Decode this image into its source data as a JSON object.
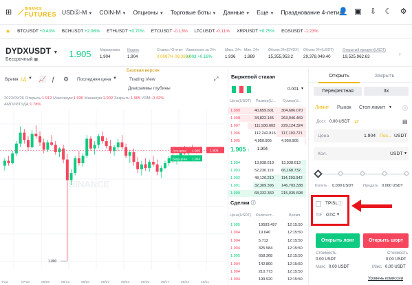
{
  "nav": {
    "brand_top": "BINANCE",
    "brand_bottom": "FUTURES",
    "items": [
      "USDⓈ-M",
      "COIN-M",
      "Опционы",
      "Торговые боты",
      "Данные",
      "Еще"
    ],
    "promo": "Празднование 4-летия Binan"
  },
  "ticker": [
    {
      "sym": "BTCUSDT",
      "chg": "+0.43%",
      "dir": "up"
    },
    {
      "sym": "BCHUSDT",
      "chg": "+2.98%",
      "dir": "up"
    },
    {
      "sym": "ETHUSDT",
      "chg": "+0.70%",
      "dir": "up"
    },
    {
      "sym": "ETCUSDT",
      "chg": "-0.13%",
      "dir": "dn"
    },
    {
      "sym": "LTCUSDT",
      "chg": "-0.11%",
      "dir": "dn"
    },
    {
      "sym": "XRPUSDT",
      "chg": "+0.75%",
      "dir": "up"
    },
    {
      "sym": "EOSUSDT",
      "chg": "-1.23%",
      "dir": "dn"
    }
  ],
  "header": {
    "symbol": "DYDXUSDT",
    "contract": "Бессрочный",
    "price": "1.905",
    "stats": [
      {
        "label": "Маркировка",
        "value": "1.904"
      },
      {
        "label": "Индекс",
        "value": "1.904"
      },
      {
        "label": "Ставка / Отсчет",
        "value": "0.0087% 06:38:40"
      },
      {
        "label": "Изменение за 24ч",
        "value": "0.003 +0.16%"
      },
      {
        "label": "Макс. 24ч",
        "value": "1.936"
      },
      {
        "label": "Мин. 24ч",
        "value": "1.889"
      },
      {
        "label": "Объем 24ч(DYDX)",
        "value": "15,355,953.2"
      },
      {
        "label": "Объем 24ч(USDT)",
        "value": "29,378,049.40"
      },
      {
        "label": "Открытый процент(USDT)",
        "value": "19,525,962.63"
      }
    ]
  },
  "chart_tools": {
    "time": "Время",
    "interval": "1Д",
    "price_type": "Последняя цена",
    "basic": "Базовая версия",
    "tv": "Trading View",
    "depth": "Диаграммы глубины"
  },
  "chart_info": {
    "line1_date": "2023/09/26",
    "open_l": "Открыть:",
    "open_v": "1.912",
    "high_l": "Максимум:",
    "high_v": "1.936",
    "low_l": "Минимум:",
    "low_v": "1.902",
    "close_l": "Закрыть:",
    "close_v": "1.905",
    "chg_l": "ИЗМ:",
    "chg_v": "-0.42%",
    "amp_l": "АМПЛИТУДА:",
    "amp_v": "1.78%"
  },
  "chart_labels": {
    "ask": "Аск-цена",
    "ask_v": "1.905",
    "bid": "Бид-цена",
    "bid_v": "1.904",
    "low_mark": "1.000",
    "watermark": "BINANCE",
    "x_ticks": [
      "7/23",
      "07/30",
      "08/06",
      "08/13",
      "08/20",
      "08/27",
      "09/03",
      "09/10",
      "09/17",
      "09/24",
      "10/01"
    ]
  },
  "chart_data": {
    "type": "candlestick",
    "note_unused": "",
    "candles": [
      [
        1.78,
        1.84,
        1.74,
        1.82
      ],
      [
        1.82,
        1.86,
        1.78,
        1.8
      ],
      [
        1.8,
        1.9,
        1.79,
        1.88
      ],
      [
        1.88,
        1.98,
        1.86,
        1.96
      ],
      [
        1.96,
        2.1,
        1.93,
        2.05
      ],
      [
        2.05,
        2.08,
        1.96,
        1.99
      ],
      [
        1.99,
        2.02,
        1.9,
        1.93
      ],
      [
        1.93,
        2.07,
        1.92,
        2.04
      ],
      [
        2.04,
        2.11,
        2.0,
        2.02
      ],
      [
        2.02,
        2.06,
        1.94,
        1.97
      ],
      [
        1.97,
        2.0,
        1.88,
        1.91
      ],
      [
        1.91,
        1.99,
        1.89,
        1.97
      ],
      [
        1.97,
        2.03,
        1.94,
        1.95
      ],
      [
        1.95,
        1.98,
        1.87,
        1.89
      ],
      [
        1.89,
        1.93,
        1.85,
        1.92
      ],
      [
        1.92,
        1.95,
        1.8,
        1.83
      ],
      [
        1.83,
        1.88,
        1.0,
        1.66
      ],
      [
        1.66,
        1.75,
        1.62,
        1.72
      ],
      [
        1.72,
        1.86,
        1.7,
        1.84
      ],
      [
        1.84,
        1.9,
        1.78,
        1.8
      ],
      [
        1.8,
        1.88,
        1.77,
        1.86
      ],
      [
        1.86,
        2.03,
        1.84,
        2.0
      ],
      [
        2.0,
        2.02,
        1.9,
        1.92
      ],
      [
        1.92,
        1.98,
        1.87,
        1.95
      ],
      [
        1.95,
        2.04,
        1.92,
        2.02
      ],
      [
        2.02,
        2.06,
        1.96,
        1.98
      ],
      [
        1.98,
        2.01,
        1.92,
        1.94
      ],
      [
        1.94,
        1.99,
        1.88,
        1.9
      ],
      [
        1.9,
        1.95,
        1.86,
        1.93
      ],
      [
        1.93,
        2.0,
        1.9,
        1.97
      ],
      [
        1.97,
        2.03,
        1.91,
        1.93
      ],
      [
        1.93,
        1.96,
        1.84,
        1.86
      ],
      [
        1.86,
        1.91,
        1.8,
        1.89
      ],
      [
        1.89,
        1.92,
        1.78,
        1.81
      ],
      [
        1.81,
        1.85,
        1.72,
        1.75
      ],
      [
        1.75,
        1.82,
        1.7,
        1.79
      ],
      [
        1.79,
        1.84,
        1.74,
        1.76
      ],
      [
        1.76,
        1.83,
        1.73,
        1.81
      ],
      [
        1.81,
        1.86,
        1.77,
        1.79
      ],
      [
        1.79,
        1.83,
        1.7,
        1.73
      ],
      [
        1.73,
        1.78,
        1.68,
        1.76
      ],
      [
        1.76,
        1.82,
        1.75,
        1.8
      ],
      [
        1.8,
        1.86,
        1.78,
        1.84
      ],
      [
        1.84,
        1.88,
        1.8,
        1.82
      ],
      [
        1.82,
        1.87,
        1.79,
        1.85
      ],
      [
        1.85,
        1.92,
        1.84,
        1.9
      ],
      [
        1.9,
        1.94,
        1.87,
        1.88
      ],
      [
        1.88,
        1.92,
        1.85,
        1.91
      ],
      [
        1.91,
        1.95,
        1.89,
        1.9
      ],
      [
        1.9,
        1.93,
        1.88,
        1.92
      ],
      [
        1.912,
        1.936,
        1.902,
        1.905
      ]
    ],
    "ylim": [
      0.95,
      2.2
    ]
  },
  "orderbook": {
    "title": "Биржевой стакан",
    "precision": "0.001",
    "col1": "Цена(USDT)",
    "col2": "Размер(U...",
    "col3": "Сумма(U...",
    "asks": [
      [
        "1.909",
        "40,659.601",
        "304,606.070"
      ],
      [
        "1.908",
        "34,822.145",
        "263,946.469"
      ],
      [
        "1.907",
        "111,930.603",
        "229,124.324"
      ],
      [
        "1.906",
        "112,242.816",
        "117,193.721"
      ],
      [
        "1.905",
        "4,950.905",
        "4,950.905"
      ]
    ],
    "mid_price": "1.905",
    "mid_sub": "1.904",
    "bids": [
      [
        "1.904",
        "13,938.613",
        "13,938.613"
      ],
      [
        "1.903",
        "52,230.119",
        "66,168.732"
      ],
      [
        "1.902",
        "48,120.210",
        "114,293.942"
      ],
      [
        "1.901",
        "32,309.396",
        "146,703.338"
      ],
      [
        "1.900",
        "68,332.360",
        "215,035.698"
      ]
    ]
  },
  "trades": {
    "title": "Сделки",
    "col1": "Цена(USDT)",
    "col2": "Количест...",
    "col3": "Время",
    "rows": [
      [
        "1.905",
        "19593.497",
        "12:15:50",
        "up"
      ],
      [
        "1.904",
        "19.040",
        "12:15:50",
        "dn"
      ],
      [
        "1.904",
        "5.712",
        "12:15:50",
        "dn"
      ],
      [
        "1.904",
        "325.584",
        "12:15:50",
        "dn"
      ],
      [
        "1.905",
        "658.368",
        "12:15:50",
        "up"
      ],
      [
        "1.904",
        "142.800",
        "12:15:50",
        "dn"
      ],
      [
        "1.904",
        "210.773",
        "12:15:50",
        "dn"
      ],
      [
        "1.904",
        "199.920",
        "12:15:50",
        "dn"
      ]
    ]
  },
  "form": {
    "tab_open": "Открыть",
    "tab_close": "Закрыть",
    "margin_mode": "Перекрестная",
    "leverage": "3x",
    "type_limit": "Лимит",
    "type_market": "Рынок",
    "type_stop": "Стоп-лимит",
    "avail_label": "Дост.",
    "avail_value": "0.00 USDT",
    "price_label": "Цена",
    "price_value": "1.904",
    "price_last": "Пос...",
    "price_unit": "USDT",
    "qty_label": "Кол.",
    "qty_unit": "USDT",
    "buy_label": "Купить",
    "buy_value": "0.000 USDT",
    "sell_label": "Продать",
    "sell_value": "0.000 USDT",
    "tpsl": "TP/SL",
    "tif_label": "TIF",
    "tif_value": "GTC",
    "btn_long": "Открыть лонг",
    "btn_short": "Открыть шорт",
    "cost_label": "Стоимость",
    "cost_long": "0.00 USDT",
    "cost_short": "0.00 USDT",
    "max_label": "Макс",
    "max_long": "0.00 USDT",
    "max_short": "0.00 USDT",
    "fee_level": "Уровень комиссии"
  },
  "colors": {
    "up": "#0ecb81",
    "down": "#f6465d",
    "brand": "#f0b90b",
    "highlight": "#e8131a"
  }
}
